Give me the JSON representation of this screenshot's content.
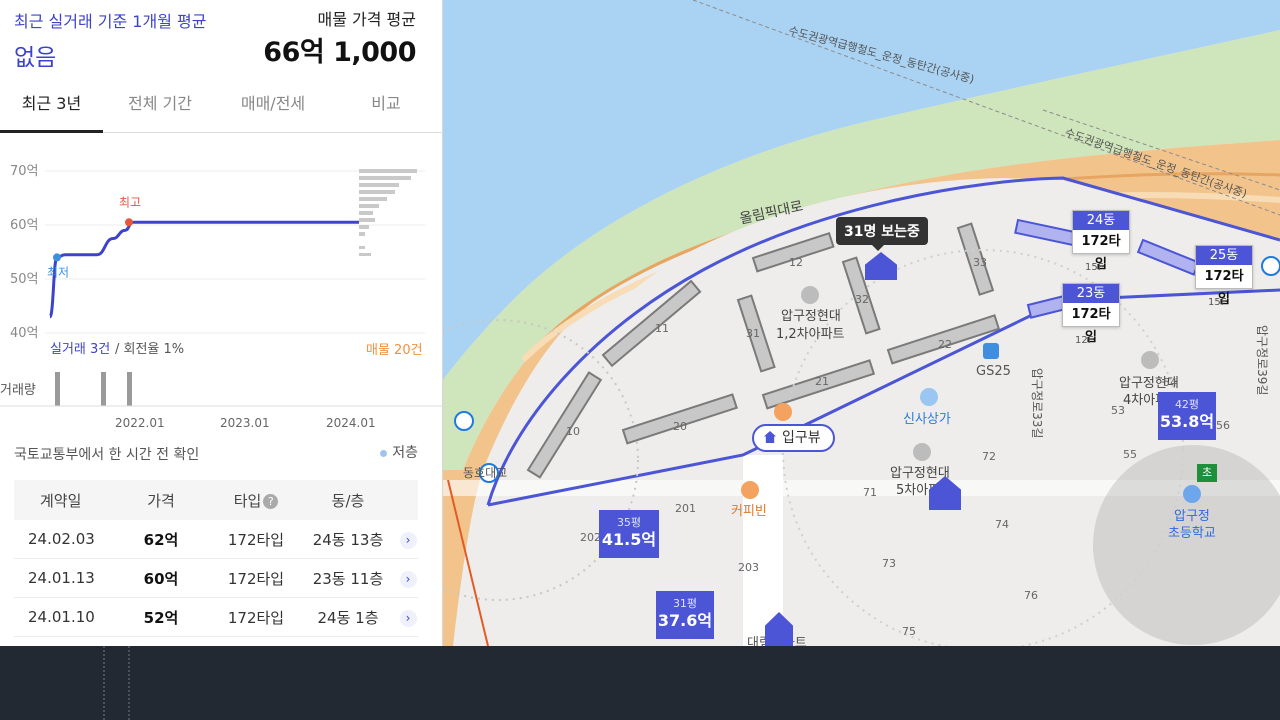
{
  "header": {
    "left_label": "최근 실거래 기준 1개월 평균",
    "left_value": "없음",
    "right_label": "매물 가격 평균",
    "right_value": "66억 1,000"
  },
  "tabs": [
    "최근 3년",
    "전체 기간",
    "매매/전세",
    "비교"
  ],
  "chart": {
    "y_ticks": [
      "70억",
      "60억",
      "50억",
      "40억"
    ],
    "x_ticks": [
      "2022.01",
      "2023.01",
      "2024.01"
    ],
    "high_label": "최고",
    "low_label": "최저",
    "trades_label": "실거래 3건",
    "turnover_label": "/ 회전율 1%",
    "listings_label": "매물 20건",
    "volume_label": "거래량",
    "line_color": "#3d44c9"
  },
  "chart_data": {
    "type": "line",
    "title": "",
    "ylabel": "",
    "ylim": [
      40,
      70
    ],
    "x": [
      "2021.04",
      "2021.06",
      "2021.08",
      "2021.10",
      "2021.12",
      "2022.02",
      "2022.04",
      "2024.06"
    ],
    "series": [
      {
        "values": [
          43,
          54,
          54.5,
          54.5,
          57.5,
          59,
          60.5,
          60.5
        ]
      }
    ]
  },
  "source_text": "국토교통부에서 한 시간 전 확인",
  "floor_legend": "저층",
  "deals": {
    "headers": [
      "계약일",
      "가격",
      "타입",
      "동/층"
    ],
    "rows": [
      {
        "date": "24.02.03",
        "price": "62억",
        "type": "172타입",
        "dong": "24동 13층"
      },
      {
        "date": "24.01.13",
        "price": "60억",
        "type": "172타입",
        "dong": "23동 11층"
      },
      {
        "date": "24.01.10",
        "price": "52억",
        "type": "172타입",
        "dong": "24동 1층"
      }
    ]
  },
  "map": {
    "road_1": "수도권광역급행철도_운정_동탄간(공사중)",
    "road_2": "수도권광역급행철도_운정_동탄간(공사중)",
    "olympic_road": "올림픽대로",
    "viewers": "31명 보는중",
    "complex_1": "압구정현대\n1,2차아파트",
    "complex_1_a": "압구정현대",
    "complex_1_b": "1,2차아파트",
    "complex_4_a": "압구정현대",
    "complex_4_b": "4차아파트",
    "complex_5_a": "압구정현대",
    "complex_5_b": "5차아파트",
    "gs25": "GS25",
    "sinsa": "신사상가",
    "place": "입구뷰",
    "cafe": "커피빈",
    "school_a": "압구정",
    "school_b": "초등학교",
    "road_33": "압구정로33길",
    "road_39": "압구정로39길",
    "station_label": "동호대교",
    "daelim": "대림빌라트",
    "tags": [
      {
        "dong": "24동",
        "type": "172타입",
        "floor": "15F"
      },
      {
        "dong": "25동",
        "type": "172타입",
        "floor": "15F"
      },
      {
        "dong": "23동",
        "type": "172타입",
        "floor": "12F"
      }
    ],
    "prices": [
      {
        "pyeong": "42평",
        "value": "53.8억"
      },
      {
        "pyeong": "35평",
        "value": "41.5억"
      },
      {
        "pyeong": "31평",
        "value": "37.6억"
      }
    ],
    "school_flag": "초",
    "building_numbers": [
      "12",
      "33",
      "32",
      "11",
      "31",
      "22",
      "21",
      "10",
      "20",
      "54",
      "53",
      "56",
      "55",
      "72",
      "71",
      "201",
      "202",
      "203",
      "74",
      "73",
      "76",
      "75"
    ]
  }
}
